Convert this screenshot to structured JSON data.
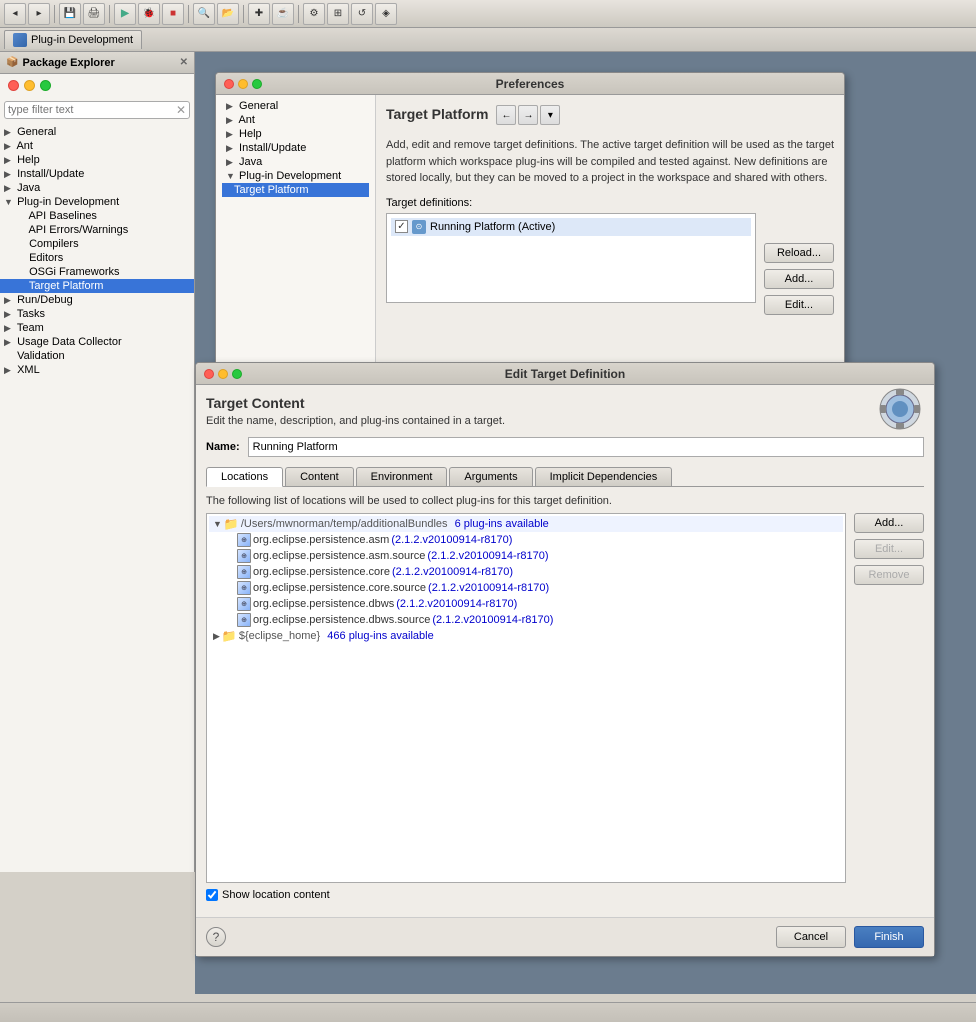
{
  "ide": {
    "toolbar": {
      "buttons": [
        "⊞",
        "↺",
        "▶",
        "⬛",
        "🔍"
      ]
    },
    "plugin_tab": {
      "label": "Plug-in Development"
    }
  },
  "package_explorer": {
    "title": "Package Explorer",
    "search_placeholder": "type filter text",
    "tree": [
      {
        "id": "general",
        "label": "General",
        "indent": 0,
        "arrow": "closed"
      },
      {
        "id": "ant",
        "label": "Ant",
        "indent": 0,
        "arrow": "closed"
      },
      {
        "id": "help",
        "label": "Help",
        "indent": 0,
        "arrow": "closed"
      },
      {
        "id": "install_update",
        "label": "Install/Update",
        "indent": 0,
        "arrow": "closed"
      },
      {
        "id": "java",
        "label": "Java",
        "indent": 0,
        "arrow": "closed"
      },
      {
        "id": "plugin_dev",
        "label": "Plug-in Development",
        "indent": 0,
        "arrow": "open"
      },
      {
        "id": "api_baselines",
        "label": "API Baselines",
        "indent": 1,
        "arrow": null
      },
      {
        "id": "api_errors",
        "label": "API Errors/Warnings",
        "indent": 1,
        "arrow": null
      },
      {
        "id": "compilers",
        "label": "Compilers",
        "indent": 1,
        "arrow": null
      },
      {
        "id": "editors",
        "label": "Editors",
        "indent": 1,
        "arrow": null
      },
      {
        "id": "osgi_frameworks",
        "label": "OSGi Frameworks",
        "indent": 1,
        "arrow": null
      },
      {
        "id": "target_platform",
        "label": "Target Platform",
        "indent": 1,
        "arrow": null,
        "selected": true
      },
      {
        "id": "run_debug",
        "label": "Run/Debug",
        "indent": 0,
        "arrow": "closed"
      },
      {
        "id": "tasks",
        "label": "Tasks",
        "indent": 0,
        "arrow": "closed"
      },
      {
        "id": "team",
        "label": "Team",
        "indent": 0,
        "arrow": "closed"
      },
      {
        "id": "usage_data",
        "label": "Usage Data Collector",
        "indent": 0,
        "arrow": "closed"
      },
      {
        "id": "validation",
        "label": "Validation",
        "indent": 0,
        "arrow": null
      },
      {
        "id": "xml",
        "label": "XML",
        "indent": 0,
        "arrow": "closed"
      }
    ]
  },
  "preferences_dialog": {
    "title": "Preferences",
    "section_title": "Target Platform",
    "description": "Add, edit and remove target definitions.  The active target definition will be used as the target platform which workspace plug-ins will be compiled and tested against.  New definitions are stored locally, but they can be moved to a project in the workspace and shared with others.",
    "target_definitions_label": "Target definitions:",
    "target_item": "Running Platform (Active)",
    "buttons": {
      "reload": "Reload...",
      "add": "Add...",
      "edit": "Edit..."
    }
  },
  "edit_target_dialog": {
    "title": "Edit Target Definition",
    "section_title": "Target Content",
    "description": "Edit the name, description, and plug-ins contained in a target.",
    "name_label": "Name:",
    "name_value": "Running Platform",
    "tabs": [
      "Locations",
      "Content",
      "Environment",
      "Arguments",
      "Implicit Dependencies"
    ],
    "active_tab": "Locations",
    "locations_description": "The following list of locations will be used to collect plug-ins for this target definition.",
    "locations": [
      {
        "id": "loc1",
        "path": "/Users/mwnorman/temp/additionalBundles",
        "count_text": "6 plug-ins available",
        "plugins": [
          {
            "name": "org.eclipse.persistence.asm",
            "version": "(2.1.2.v20100914-r8170)"
          },
          {
            "name": "org.eclipse.persistence.asm.source",
            "version": "(2.1.2.v20100914-r8170)"
          },
          {
            "name": "org.eclipse.persistence.core",
            "version": "(2.1.2.v20100914-r8170)"
          },
          {
            "name": "org.eclipse.persistence.core.source",
            "version": "(2.1.2.v20100914-r8170)"
          },
          {
            "name": "org.eclipse.persistence.dbws",
            "version": "(2.1.2.v20100914-r8170)"
          },
          {
            "name": "org.eclipse.persistence.dbws.source",
            "version": "(2.1.2.v20100914-r8170)"
          }
        ]
      },
      {
        "id": "loc2",
        "path": "${eclipse_home}",
        "count_text": "466 plug-ins available",
        "plugins": []
      }
    ],
    "location_buttons": {
      "add": "Add...",
      "edit": "Edit...",
      "remove": "Remove"
    },
    "show_location_content_label": "Show location content",
    "show_location_content_checked": true,
    "footer_buttons": {
      "cancel": "Cancel",
      "finish": "Finish"
    }
  }
}
